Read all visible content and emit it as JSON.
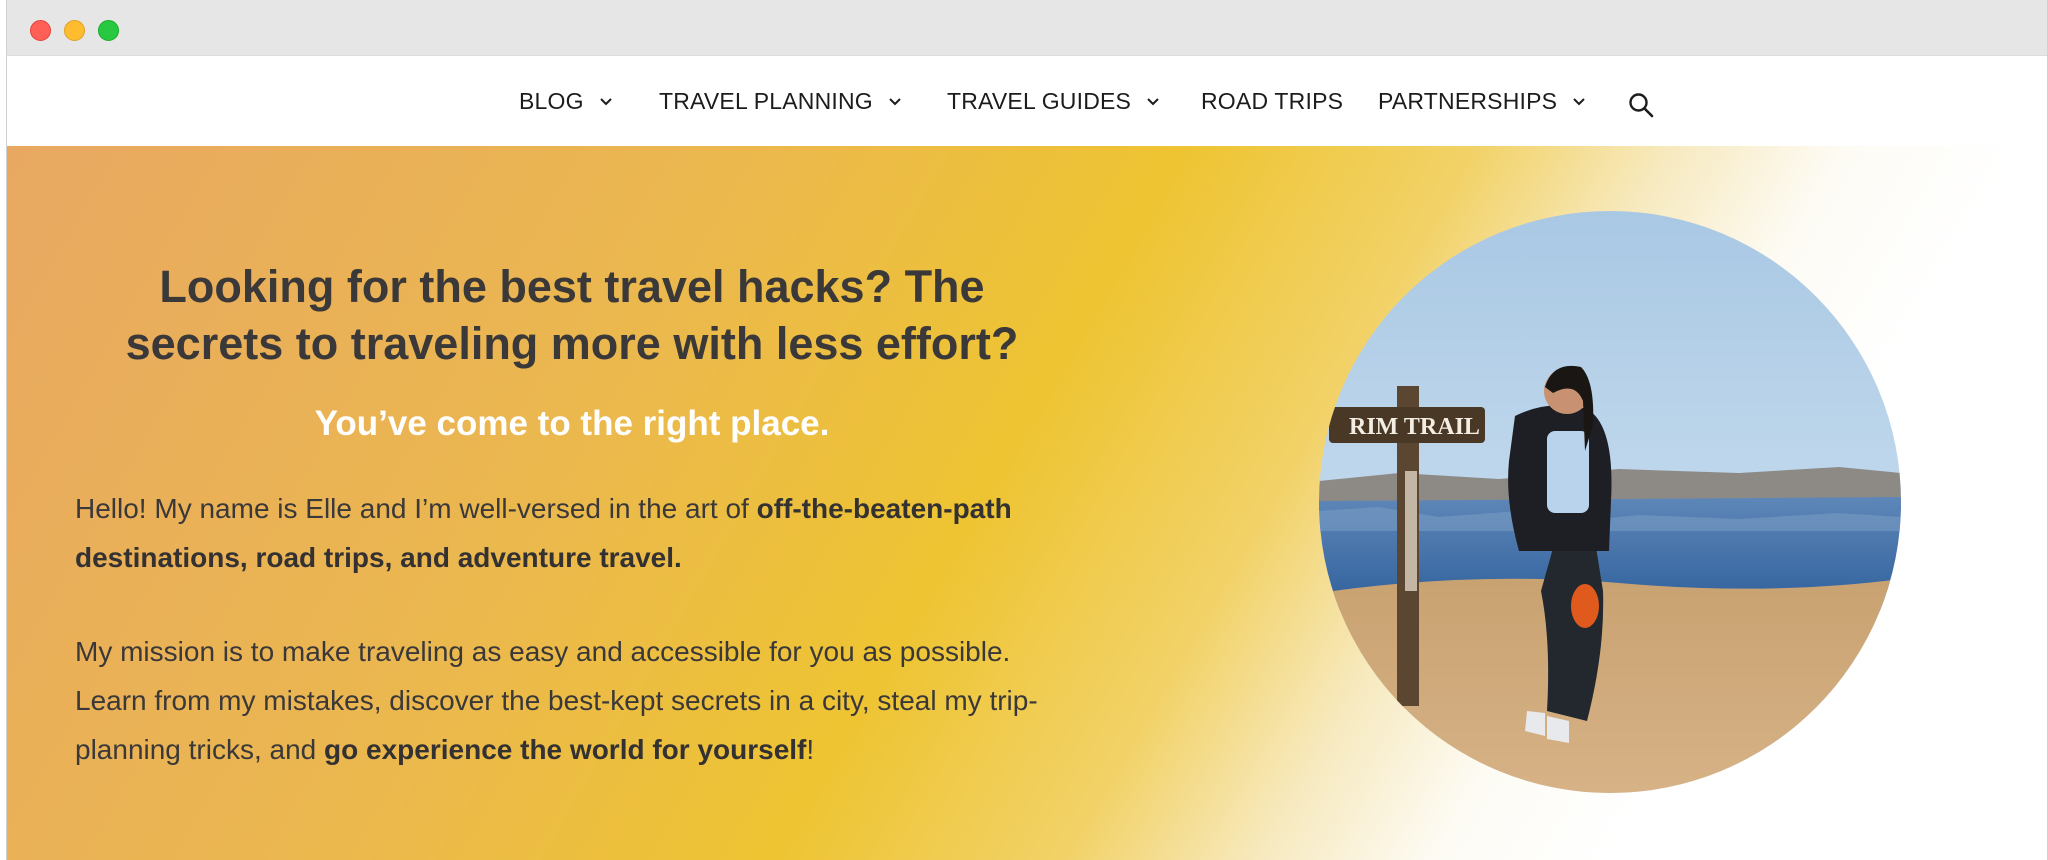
{
  "nav": {
    "items": [
      {
        "label": "BLOG",
        "has_dropdown": true
      },
      {
        "label": "TRAVEL PLANNING",
        "has_dropdown": true
      },
      {
        "label": "TRAVEL GUIDES",
        "has_dropdown": true
      },
      {
        "label": "ROAD TRIPS",
        "has_dropdown": false
      },
      {
        "label": "PARTNERSHIPS",
        "has_dropdown": true
      }
    ],
    "search_icon": "search-icon"
  },
  "hero": {
    "headline_line1": "Looking for the best travel hacks? The",
    "headline_line2": "secrets to traveling more with less effort?",
    "subheadline": "You’ve come to the right place.",
    "intro_prefix": "Hello! My name is Elle and I’m well-versed in the art of ",
    "intro_bold": "off-the-beaten-path destinations, road trips, and adventure travel.",
    "mission_prefix": "My mission is to make traveling as easy and accessible for you as possible. Learn from my mistakes, discover the best-kept secrets in a city, steal my trip-planning tricks, and ",
    "mission_bold": "go experience the world for yourself",
    "mission_suffix": "!",
    "photo_sign_text": "RIM TRAIL"
  },
  "colors": {
    "gradient_start": "#e8a862",
    "gradient_mid": "#eec432",
    "heading_text": "#3a3838",
    "subheading_text": "#ffffff"
  }
}
